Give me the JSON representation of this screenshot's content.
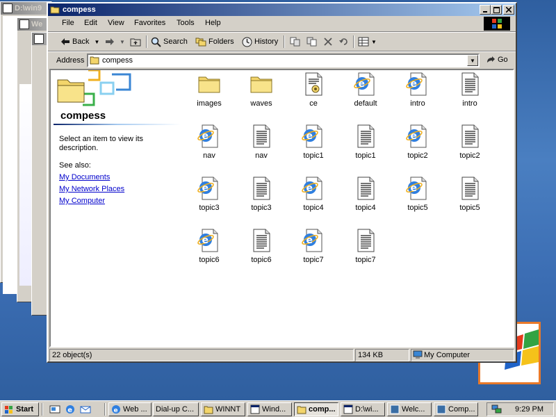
{
  "window": {
    "title": "compess",
    "menu": [
      "File",
      "Edit",
      "View",
      "Favorites",
      "Tools",
      "Help"
    ],
    "toolbar": {
      "back": "Back",
      "search": "Search",
      "folders": "Folders",
      "history": "History"
    },
    "address": {
      "label": "Address",
      "value": "compess",
      "go": "Go"
    }
  },
  "left_pane": {
    "title": "compess",
    "description": "Select an item to view its description.",
    "see_also": "See also:",
    "links": [
      "My Documents",
      "My Network Places",
      "My Computer"
    ]
  },
  "files": [
    {
      "name": "images",
      "icon": "folder-icon"
    },
    {
      "name": "waves",
      "icon": "folder-icon"
    },
    {
      "name": "ce",
      "icon": "setup-file-icon"
    },
    {
      "name": "default",
      "icon": "ie-html-icon"
    },
    {
      "name": "intro",
      "icon": "ie-html-icon"
    },
    {
      "name": "intro",
      "icon": "text-document-icon"
    },
    {
      "name": "nav",
      "icon": "ie-html-icon"
    },
    {
      "name": "nav",
      "icon": "text-document-icon"
    },
    {
      "name": "topic1",
      "icon": "ie-html-icon"
    },
    {
      "name": "topic1",
      "icon": "text-document-icon"
    },
    {
      "name": "topic2",
      "icon": "ie-html-icon"
    },
    {
      "name": "topic2",
      "icon": "text-document-icon"
    },
    {
      "name": "topic3",
      "icon": "ie-html-icon"
    },
    {
      "name": "topic3",
      "icon": "text-document-icon"
    },
    {
      "name": "topic4",
      "icon": "ie-html-icon"
    },
    {
      "name": "topic4",
      "icon": "text-document-icon"
    },
    {
      "name": "topic5",
      "icon": "ie-html-icon"
    },
    {
      "name": "topic5",
      "icon": "text-document-icon"
    },
    {
      "name": "topic6",
      "icon": "ie-html-icon"
    },
    {
      "name": "topic6",
      "icon": "text-document-icon"
    },
    {
      "name": "topic7",
      "icon": "ie-html-icon"
    },
    {
      "name": "topic7",
      "icon": "text-document-icon"
    }
  ],
  "status": {
    "objects": "22 object(s)",
    "size": "134 KB",
    "zone": "My Computer"
  },
  "background_windows": [
    {
      "title": "D:\\win9"
    },
    {
      "title": "We"
    }
  ],
  "taskbar": {
    "start": "Start",
    "buttons": [
      {
        "label": "Web ...",
        "icon": "ie-icon"
      },
      {
        "label": "Dial-up C...",
        "icon": "none"
      },
      {
        "label": "WINNT",
        "icon": "folder-icon"
      },
      {
        "label": "Wind...",
        "icon": "app-icon"
      },
      {
        "label": "comp...",
        "icon": "folder-icon",
        "pressed": true
      },
      {
        "label": "D:\\wi...",
        "icon": "app-icon"
      },
      {
        "label": "Welc...",
        "icon": "window-icon"
      },
      {
        "label": "Comp...",
        "icon": "window-icon"
      }
    ],
    "clock": "9:29 PM"
  },
  "colors": {
    "title_active": "#0a246a",
    "title_gradient_end": "#a6caf0",
    "face": "#d4d0c8",
    "desktop": "#3a6ea5",
    "link": "#0000cc"
  }
}
